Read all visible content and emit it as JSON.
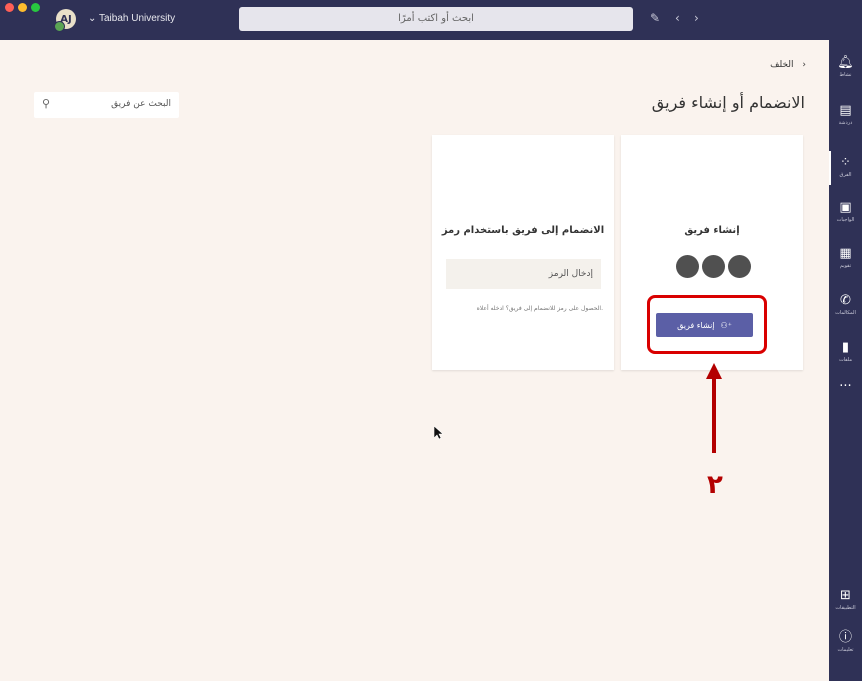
{
  "window": {
    "avatar_initials": "AJ",
    "org_name": "⌄ Taibah University",
    "search_placeholder": "ابحث أو اكتب أمرًا"
  },
  "rail": {
    "items": [
      {
        "label": "نشاط",
        "icon": "bell-icon"
      },
      {
        "label": "دردشة",
        "icon": "chat-icon"
      },
      {
        "label": "الفرق",
        "icon": "teams-icon"
      },
      {
        "label": "الواجبات",
        "icon": "assignments-icon"
      },
      {
        "label": "تقويم",
        "icon": "calendar-icon"
      },
      {
        "label": "المكالمات",
        "icon": "phone-icon"
      },
      {
        "label": "ملفات",
        "icon": "file-icon"
      }
    ],
    "more": "···",
    "apps_label": "التطبيقات",
    "help_label": "تعليمات"
  },
  "main": {
    "back_label": "الخلف",
    "heading": "الانضمام أو إنشاء فريق",
    "team_search_placeholder": "البحث عن فريق"
  },
  "create_card": {
    "title": "إنشاء فريق",
    "button_label": "إنشاء فريق"
  },
  "join_card": {
    "title": "الانضمام إلى فريق باستخدام رمز",
    "input_placeholder": "إدخال الرمز",
    "help_text": "الحصول على رمز للانضمام إلى فريق؟ ادخله أعلاه."
  },
  "annotation": {
    "label": "٢",
    "color": "#b30000"
  },
  "colors": {
    "titlebar": "#2f3156",
    "accent": "#5b5fa6",
    "highlight": "#d90000"
  }
}
